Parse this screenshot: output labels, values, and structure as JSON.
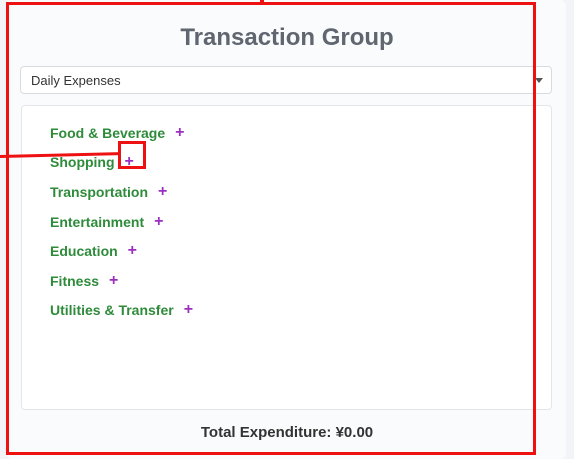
{
  "title": "Transaction Group",
  "group_select": {
    "value": "Daily Expenses"
  },
  "categories": [
    {
      "label": "Food & Beverage",
      "add": "+"
    },
    {
      "label": "Shopping",
      "add": "+"
    },
    {
      "label": "Transportation",
      "add": "+"
    },
    {
      "label": "Entertainment",
      "add": "+"
    },
    {
      "label": "Education",
      "add": "+"
    },
    {
      "label": "Fitness",
      "add": "+"
    },
    {
      "label": "Utilities & Transfer",
      "add": "+"
    }
  ],
  "total": {
    "text": "Total Expenditure: ¥0.00"
  },
  "colors": {
    "category_text": "#2e8b3a",
    "add_button": "#9b30c0",
    "annotation": "#ee1111"
  },
  "icons": {
    "select_caret": "chevron-down-icon",
    "add": "plus-icon"
  }
}
